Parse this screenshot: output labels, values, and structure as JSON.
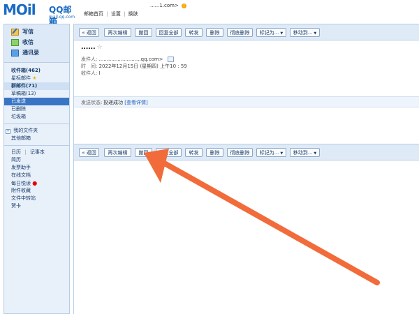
{
  "header": {
    "logo_text": "MOil",
    "logo_qq": "QQ邮箱",
    "logo_domain": "mail.qq.com",
    "nav": [
      "邮箱首页",
      "设置",
      "换肤"
    ],
    "separator": "|",
    "user_email": "......1.com>",
    "notice_icon": "!"
  },
  "sidebar": {
    "actions": [
      {
        "label": "写信",
        "icon": "pencil-icon"
      },
      {
        "label": "收信",
        "icon": "inbox-icon"
      },
      {
        "label": "通讯录",
        "icon": "contacts-icon"
      }
    ],
    "folders": [
      {
        "label": "收件箱(462)"
      },
      {
        "label": "星标邮件",
        "star": "★"
      },
      {
        "label": "群邮件(71)"
      },
      {
        "label": "草稿箱(13)"
      },
      {
        "label": "已发送"
      },
      {
        "label": "已删除"
      },
      {
        "label": "垃圾箱"
      }
    ],
    "my_folders": "我的文件夹",
    "plus_sign": "+",
    "other_mailbox": "其他邮箱",
    "tools": [
      {
        "label": "日历"
      },
      {
        "label": "简历"
      },
      {
        "label": "发票助手"
      },
      {
        "label": "在线文档"
      },
      {
        "label": "每日悦读",
        "dot": "●"
      },
      {
        "label": "附件收藏"
      },
      {
        "label": "文件中转站"
      },
      {
        "label": "贺卡"
      }
    ],
    "tool_separator": "|",
    "notebook": "记事本"
  },
  "toolbar": {
    "back": "« 返回",
    "edit_again": "再次编辑",
    "recall": "撤回",
    "reply_all": "回复全部",
    "forward": "转发",
    "delete": "删除",
    "delete_permanent": "彻底删除",
    "mark_as": "标记为...",
    "move_to": "移动到...",
    "dropdown": "▼"
  },
  "message": {
    "subject": "......",
    "star": "☆",
    "sender_label": "发件人:",
    "sender_value": "...........................qq.com>",
    "time_label": "时　间:",
    "time_value": "2022年12月15日 (星期四) 上午10 : 59",
    "recipient_label": "收件人:",
    "recipient_value": "I",
    "status_label": "发送状态:",
    "status_value": "投递成功",
    "status_link": "[查看详情]"
  },
  "colors": {
    "arrow": "#f26b3a",
    "brand": "#1b6bc4",
    "active_folder": "#3a75c4"
  }
}
